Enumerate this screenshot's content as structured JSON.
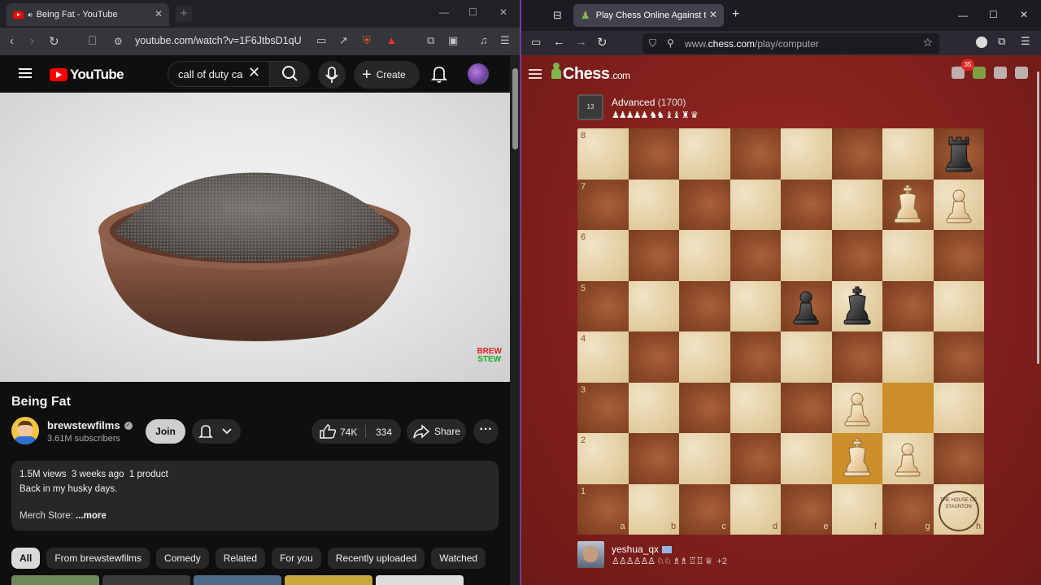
{
  "left_window": {
    "tab_title": "Being Fat - YouTube",
    "url": "youtube.com/watch?v=1F6JtbsD1qU",
    "search_query": "call of duty ca",
    "create_label": "Create",
    "brand_word": "YouTube",
    "video": {
      "title": "Being Fat",
      "channel": "brewstewfilms",
      "subscribers": "3.61M subscribers",
      "join_label": "Join",
      "likes": "74K",
      "dislikes": "334",
      "share_label": "Share",
      "watermark_top": "BREW",
      "watermark_bottom": "STEW"
    },
    "description": {
      "views": "1.5M views",
      "age": "3 weeks ago",
      "products": "1 product",
      "line1": "Back in my husky days.",
      "line2": "Merch Store: ",
      "more": "...more"
    },
    "chips": [
      "All",
      "From brewstewfilms",
      "Comedy",
      "Related",
      "For you",
      "Recently uploaded",
      "Watched"
    ]
  },
  "right_window": {
    "tab_title": "Play Chess Online Against the C",
    "url_prefix": "www.",
    "url_main": "chess.com",
    "url_suffix": "/play/computer",
    "logo_word": "Chess",
    "logo_suffix": ".com",
    "notification_count": "35",
    "opponent": {
      "badge": "13",
      "name": "Advanced",
      "rating": "(1700)",
      "captured": "♟♟♟♟♟ ♞♞ ♝♝ ♜ ♛"
    },
    "player": {
      "name": "yeshua_qx",
      "captured": "♙♙♙♙♙♙ ♘♘ ♗♗ ♖♖ ♕",
      "advantage": "+2"
    },
    "files": [
      "a",
      "b",
      "c",
      "d",
      "e",
      "f",
      "g",
      "h"
    ],
    "ranks": [
      "8",
      "7",
      "6",
      "5",
      "4",
      "3",
      "2",
      "1"
    ],
    "pieces": [
      {
        "square": "h8",
        "type": "rook",
        "color": "black"
      },
      {
        "square": "g7",
        "type": "king",
        "color": "white"
      },
      {
        "square": "h7",
        "type": "pawn",
        "color": "white"
      },
      {
        "square": "e5",
        "type": "pawn",
        "color": "black"
      },
      {
        "square": "f5",
        "type": "king",
        "color": "black"
      },
      {
        "square": "f3",
        "type": "pawn",
        "color": "white"
      },
      {
        "square": "f2",
        "type": "king",
        "color": "white"
      },
      {
        "square": "g2",
        "type": "pawn",
        "color": "white"
      }
    ],
    "highlighted_squares": [
      "g3",
      "f2"
    ],
    "watermark": "THE HOUSE OF STAUNTON"
  }
}
